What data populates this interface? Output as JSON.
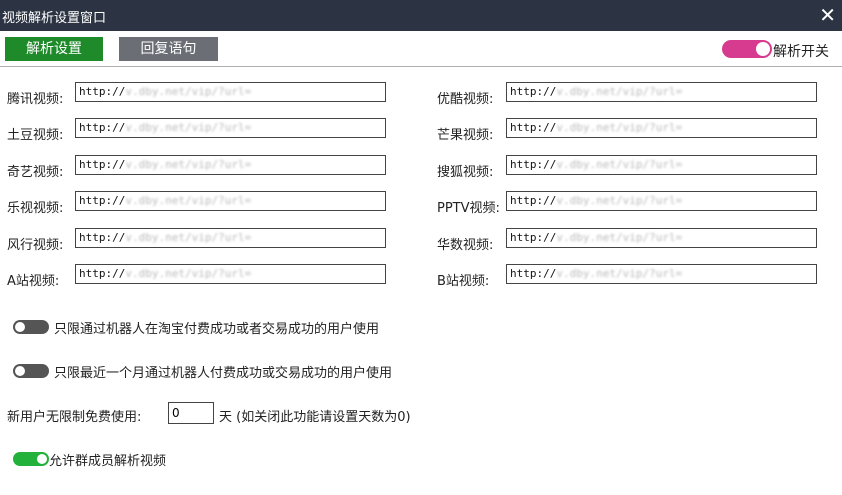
{
  "window": {
    "title": "视频解析设置窗口",
    "close_label": "✕"
  },
  "tabs": [
    {
      "label": "解析设置"
    },
    {
      "label": "回复语句"
    }
  ],
  "master_switch": {
    "label": "解析开关",
    "on": true,
    "color": "#d63b8f"
  },
  "url_prefix": "http://",
  "url_blurred": "v.dby.net/vip/?url=",
  "left_rows": [
    {
      "label": "腾讯视频:"
    },
    {
      "label": "土豆视频:"
    },
    {
      "label": "奇艺视频:"
    },
    {
      "label": "乐视视频:"
    },
    {
      "label": "风行视频:"
    },
    {
      "label": "A站视频:"
    }
  ],
  "right_rows": [
    {
      "label": "优酷视频:"
    },
    {
      "label": "芒果视频:"
    },
    {
      "label": "搜狐视频:"
    },
    {
      "label": "PPTV视频:"
    },
    {
      "label": "华数视频:"
    },
    {
      "label": "B站视频:"
    }
  ],
  "options": [
    {
      "label": "只限通过机器人在淘宝付费成功或者交易成功的用户使用",
      "on": false
    },
    {
      "label": "只限最近一个月通过机器人付费成功或交易成功的用户使用",
      "on": false
    }
  ],
  "free_days": {
    "label": "新用户无限制免费使用:",
    "value": "0",
    "suffix": "天 (如关闭此功能请设置天数为0)"
  },
  "group_option": {
    "label": "允许群成员解析视频",
    "on": true,
    "color": "#22b13a"
  },
  "colors": {
    "titlebar": "#2c3443",
    "active_tab": "#1e8a2a",
    "inactive_tab": "#6b6e74"
  }
}
